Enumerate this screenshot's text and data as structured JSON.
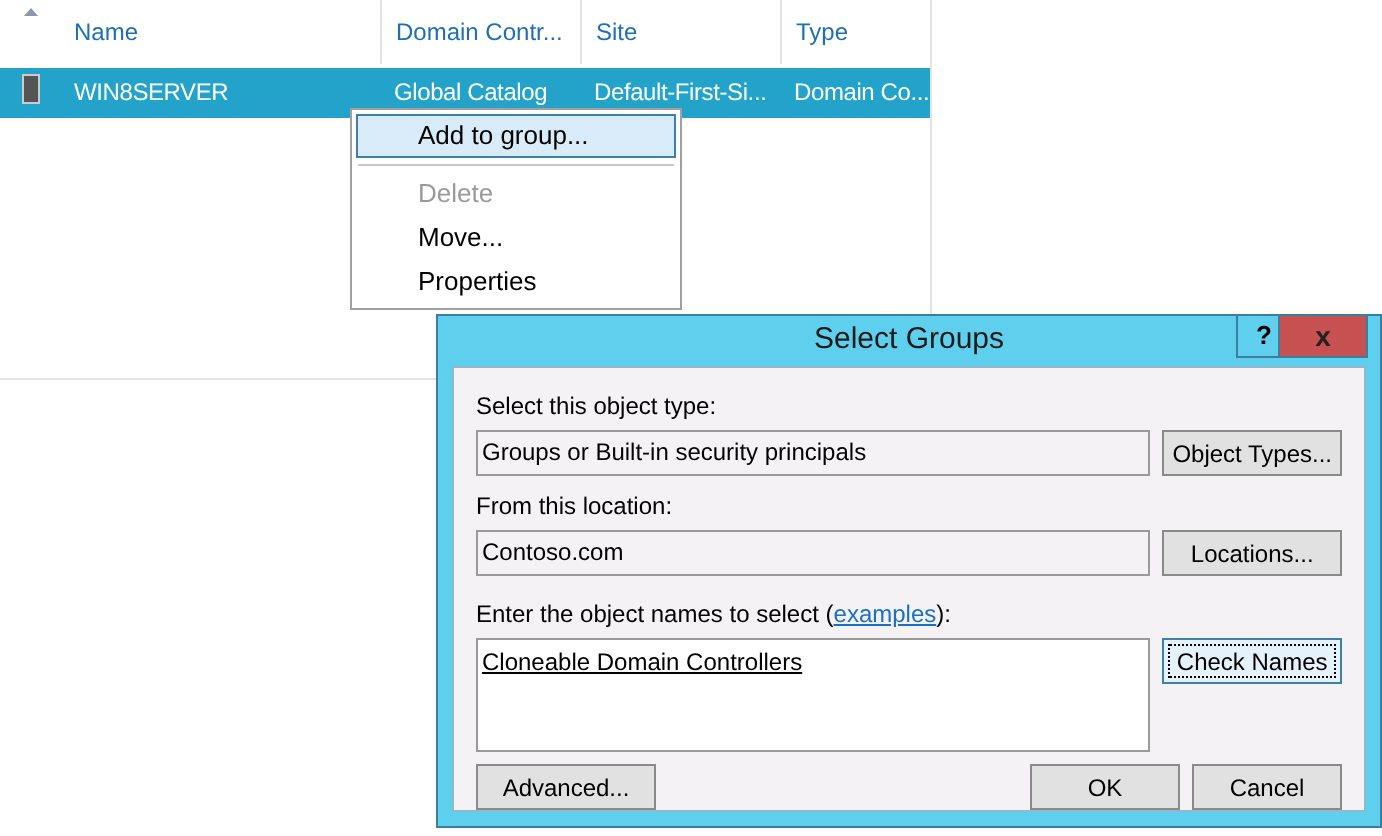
{
  "list": {
    "columns": [
      {
        "label": "Name"
      },
      {
        "label": "Domain Contr..."
      },
      {
        "label": "Site"
      },
      {
        "label": "Type"
      }
    ],
    "rows": [
      {
        "selected": true,
        "name": "WIN8SERVER",
        "role": "Global Catalog",
        "site": "Default-First-Si...",
        "type": "Domain Co..."
      }
    ]
  },
  "context_menu": {
    "items": [
      {
        "kind": "item",
        "label": "Add to group...",
        "selected": true,
        "disabled": false
      },
      {
        "kind": "separator"
      },
      {
        "kind": "item",
        "label": "Delete",
        "selected": false,
        "disabled": true
      },
      {
        "kind": "item",
        "label": "Move...",
        "selected": false,
        "disabled": false
      },
      {
        "kind": "item",
        "label": "Properties",
        "selected": false,
        "disabled": false
      }
    ]
  },
  "dialog": {
    "title": "Select Groups",
    "help": "?",
    "close": "x",
    "object_type": {
      "label": "Select this object type:",
      "value": "Groups or Built-in security principals",
      "button": "Object Types..."
    },
    "location": {
      "label": "From this location:",
      "value": "Contoso.com",
      "button": "Locations..."
    },
    "names": {
      "label": "Enter the object names to select (",
      "link": "examples",
      "label_end": "):",
      "value": "Cloneable Domain Controllers",
      "button": "Check Names"
    },
    "buttons": {
      "advanced": "Advanced...",
      "ok": "OK",
      "cancel": "Cancel"
    }
  }
}
